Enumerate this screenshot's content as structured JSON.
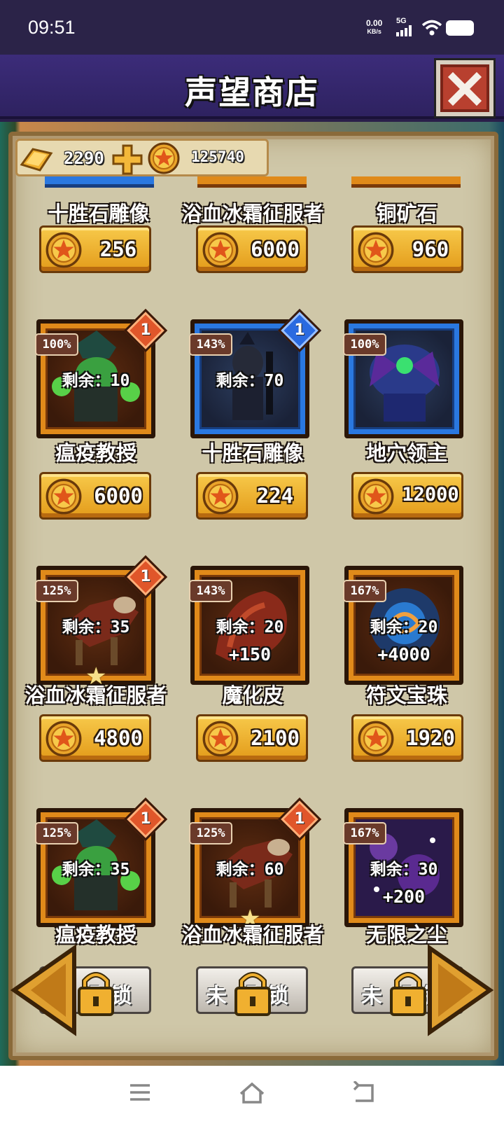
{
  "status_bar": {
    "time": "09:51",
    "net_speed": "0.00",
    "net_unit": "KB/s",
    "network": "5G"
  },
  "title": "声望商店",
  "currency": {
    "gold": "2290",
    "coins": "125740"
  },
  "top_row": [
    {
      "name": "十胜石雕像",
      "price": "256"
    },
    {
      "name": "浴血冰霜征服者",
      "price": "6000"
    },
    {
      "name": "铜矿石",
      "price": "960"
    }
  ],
  "items": [
    {
      "name": "瘟疫教授",
      "price": "6000",
      "percent": "100%",
      "remain": "剩余：10",
      "badge": "1",
      "bonus": ""
    },
    {
      "name": "十胜石雕像",
      "price": "224",
      "percent": "143%",
      "remain": "剩余：70",
      "badge": "1",
      "bonus": ""
    },
    {
      "name": "地穴领主",
      "price": "12000",
      "percent": "100%",
      "remain": "",
      "badge": "",
      "bonus": ""
    },
    {
      "name": "浴血冰霜征服者",
      "price": "4800",
      "percent": "125%",
      "remain": "剩余：35",
      "badge": "1",
      "bonus": ""
    },
    {
      "name": "魔化皮",
      "price": "2100",
      "percent": "143%",
      "remain": "剩余：20",
      "badge": "",
      "bonus": "+150"
    },
    {
      "name": "符文宝珠",
      "price": "1920",
      "percent": "167%",
      "remain": "剩余：20",
      "badge": "",
      "bonus": "+4000"
    },
    {
      "name": "瘟疫教授",
      "price": "",
      "percent": "125%",
      "remain": "剩余：35",
      "badge": "1",
      "bonus": "",
      "locked": "未解锁"
    },
    {
      "name": "浴血冰霜征服者",
      "price": "",
      "percent": "125%",
      "remain": "剩余：60",
      "badge": "1",
      "bonus": "",
      "locked": "未解锁"
    },
    {
      "name": "无限之尘",
      "price": "",
      "percent": "167%",
      "remain": "剩余：30",
      "badge": "",
      "bonus": "+200",
      "locked": "未解锁"
    }
  ],
  "colors": {
    "title_bar": "#3c2c7a",
    "parchment": "#cfc7a8",
    "price_button": "#f0b030",
    "frame_orange": "#e08a1a",
    "frame_blue": "#2a78e0"
  },
  "icons": [
    "gold-bar-icon",
    "plus-icon",
    "coin-icon",
    "close-icon",
    "padlock-icon",
    "left-arrow-icon",
    "right-arrow-icon",
    "menu-icon",
    "home-icon",
    "back-icon"
  ]
}
